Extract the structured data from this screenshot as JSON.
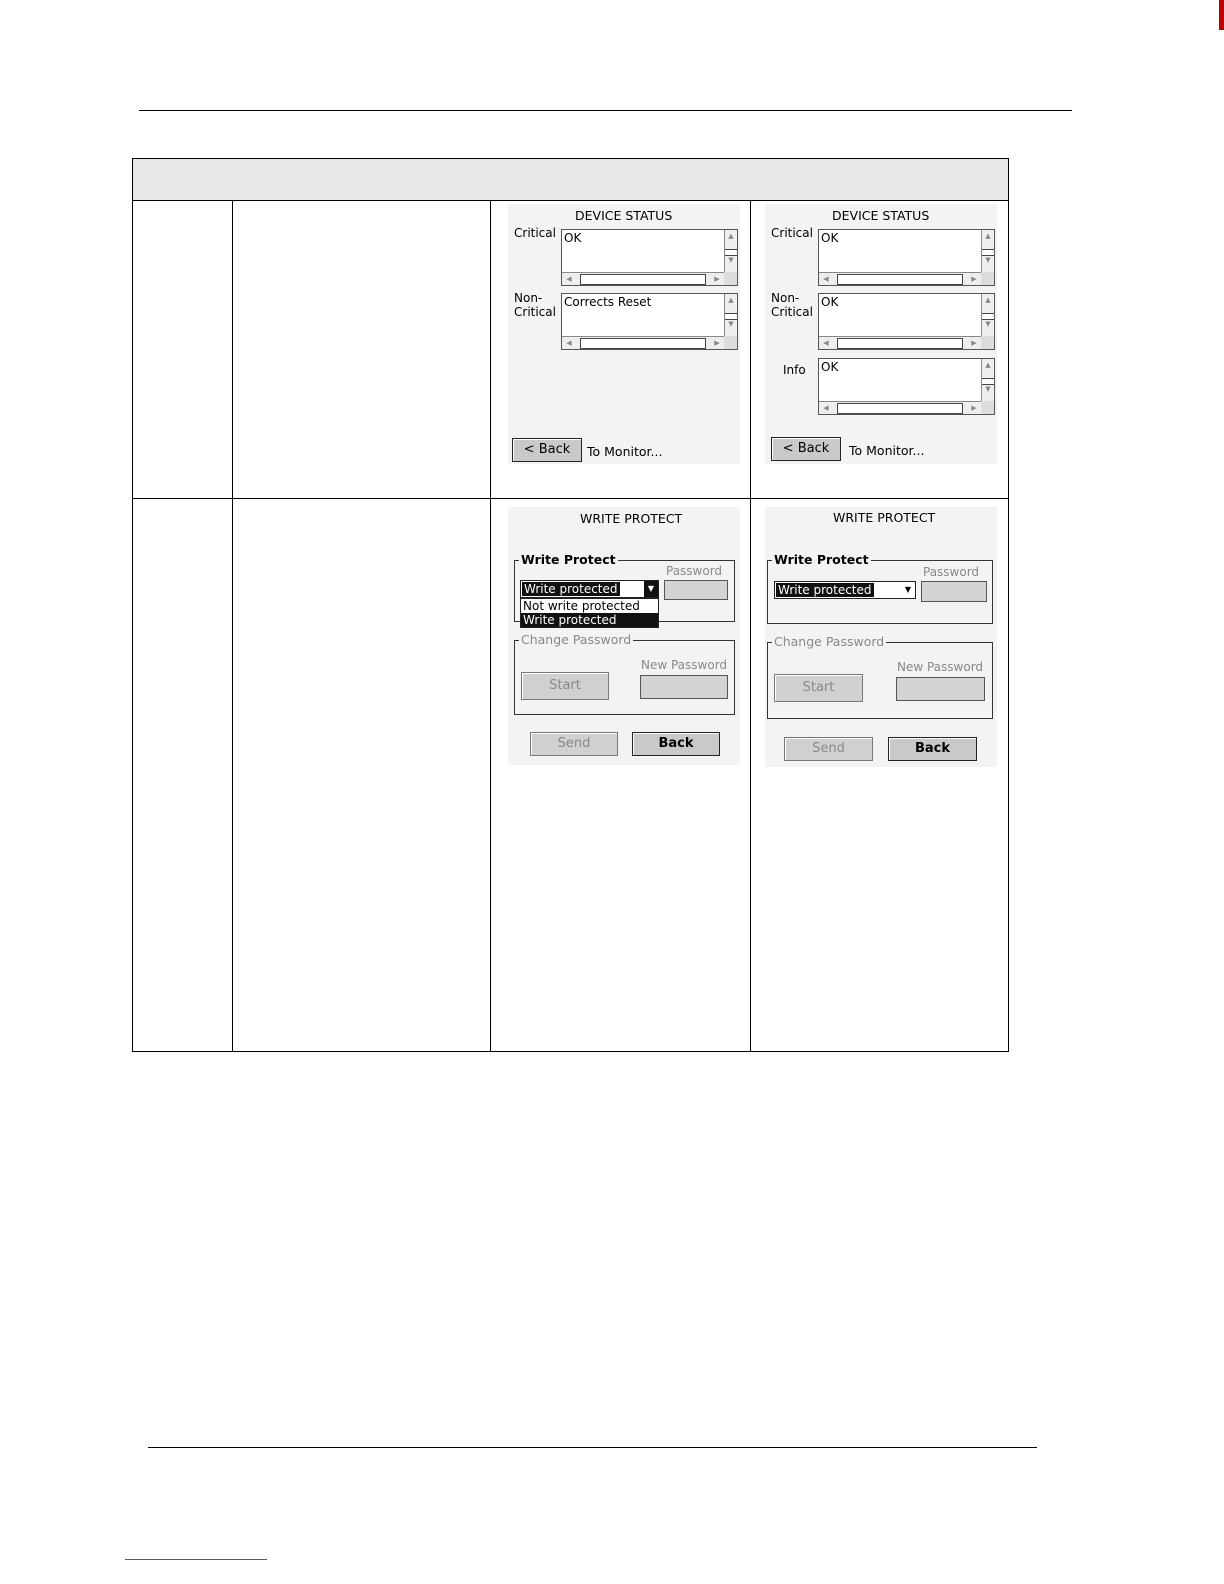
{
  "device_status_left": {
    "title": "DEVICE STATUS",
    "critical_label": "Critical",
    "critical_value": "OK",
    "noncritical_label_1": "Non-",
    "noncritical_label_2": "Critical",
    "noncritical_value": "Corrects Reset",
    "back_label": "< Back",
    "back_hint": "To Monitor..."
  },
  "device_status_right": {
    "title": "DEVICE STATUS",
    "critical_label": "Critical",
    "critical_value": "OK",
    "noncritical_label_1": "Non-",
    "noncritical_label_2": "Critical",
    "noncritical_value": "OK",
    "info_label": "Info",
    "info_value": "OK",
    "back_label": "< Back",
    "back_hint": "To Monitor..."
  },
  "write_protect_left": {
    "title": "WRITE PROTECT",
    "group_label": "Write Protect",
    "selected": "Write protected",
    "options": [
      "Not write protected",
      "Write protected"
    ],
    "password_label": "Password",
    "change_group_label": "Change Password",
    "new_password_label": "New Password",
    "start_label": "Start",
    "send_label": "Send",
    "back_label": "Back"
  },
  "write_protect_right": {
    "title": "WRITE PROTECT",
    "group_label": "Write Protect",
    "selected": "Write protected",
    "password_label": "Password",
    "change_group_label": "Change Password",
    "new_password_label": "New Password",
    "start_label": "Start",
    "send_label": "Send",
    "back_label": "Back"
  }
}
